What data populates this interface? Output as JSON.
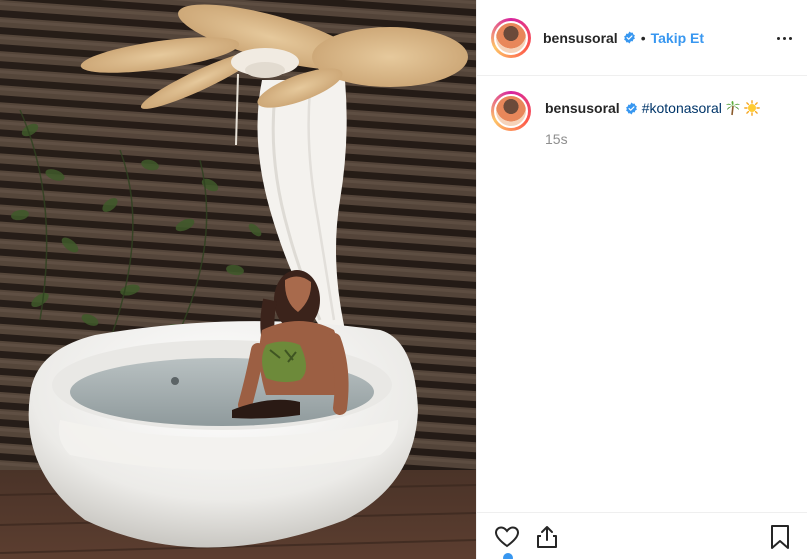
{
  "post": {
    "image_alt": "Woman in green bikini sitting in a round white outdoor bathtub under a wicker ceiling fan",
    "header": {
      "username": "bensusoral",
      "separator": "•",
      "follow_label": "Takip Et",
      "more_icon": "more-horizontal-icon"
    },
    "caption": {
      "username": "bensusoral",
      "hashtag": "#kotonasoral",
      "emojis": [
        "palm-tree",
        "sun"
      ],
      "time": "15s"
    },
    "actions": {
      "like_icon": "heart-icon",
      "share_icon": "share-icon",
      "save_icon": "bookmark-icon"
    }
  },
  "colors": {
    "link_blue": "#3897f0",
    "hashtag": "#003569",
    "verified_blue": "#3897f0",
    "meta_gray": "#8e8e8e",
    "border": "#efefef"
  }
}
